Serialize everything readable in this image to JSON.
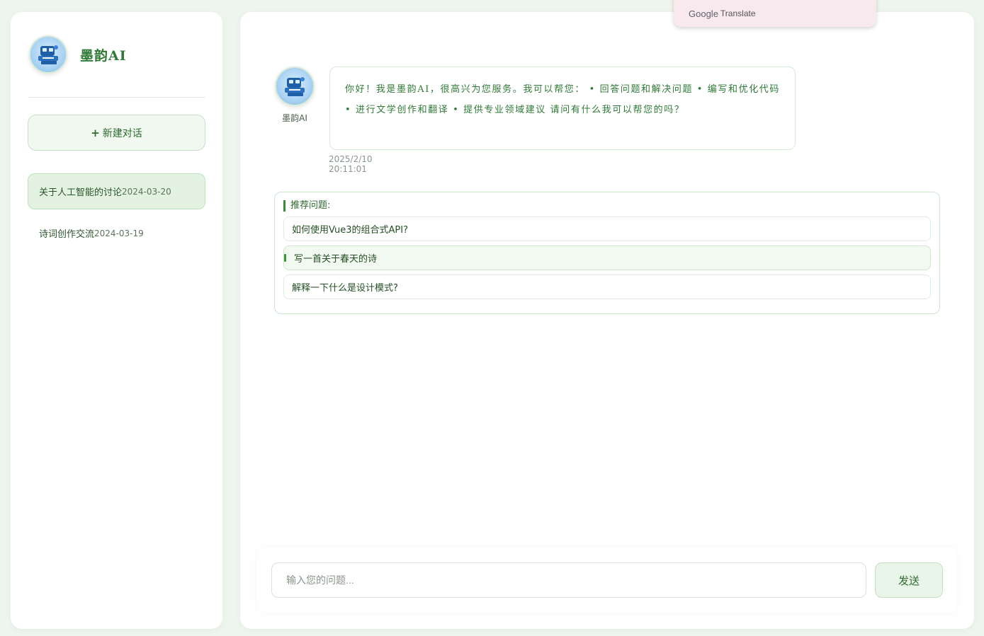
{
  "sidebar": {
    "brand_name": "墨韵AI",
    "new_chat_label": "新建对话",
    "new_chat_icon": "+",
    "conversations": [
      {
        "title": "关于人工智能的讨论",
        "date": "2024-03-20",
        "active": true
      },
      {
        "title": "诗词创作交流",
        "date": "2024-03-19",
        "active": false
      }
    ]
  },
  "chat": {
    "messages": [
      {
        "sender": "墨韵AI",
        "text": "你好！我是墨韵AI，很高兴为您服务。我可以帮您： • 回答问题和解决问题 • 编写和优化代码 • 进行文学创作和翻译 • 提供专业领域建议 请问有什么我可以帮您的吗？",
        "time": "2025/2/10 20:11:01"
      }
    ],
    "suggestions": {
      "title": "推荐问题:",
      "items": [
        "如何使用Vue3的组合式API?",
        "写一首关于春天的诗",
        "解释一下什么是设计模式?"
      ]
    }
  },
  "composer": {
    "placeholder": "输入您的问题...",
    "send_label": "发送"
  },
  "translate_popup": {
    "brand": "Google",
    "label": "Translate"
  },
  "colors": {
    "page_bg": "#eef5ee",
    "accent_green": "#2f7a36",
    "active_item_bg": "#e3f2e1",
    "popup_bg": "#f8e9ef"
  }
}
